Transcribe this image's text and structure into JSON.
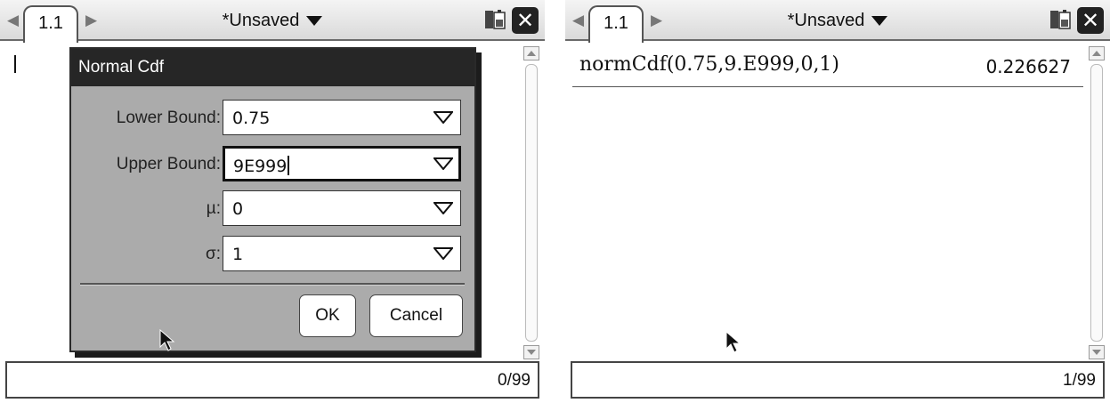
{
  "left_screen": {
    "page_tab": "1.1",
    "doc_title": "*Unsaved",
    "status_count": "0/99",
    "dialog": {
      "title": "Normal Cdf",
      "fields": [
        {
          "label": "Lower Bound:",
          "value": "0.75"
        },
        {
          "label": "Upper Bound:",
          "value": "9E999"
        },
        {
          "label": "µ:",
          "value": "0"
        },
        {
          "label": "σ:",
          "value": "1"
        }
      ],
      "ok_label": "OK",
      "cancel_label": "Cancel"
    }
  },
  "right_screen": {
    "page_tab": "1.1",
    "doc_title": "*Unsaved",
    "status_count": "1/99",
    "history": [
      {
        "expression": "normCdf(0.75,9.E999,0,1)",
        "result": "0.226627"
      }
    ]
  },
  "icons": {
    "battery": "battery-icon",
    "close": "close-icon",
    "dropdown": "chevron-down-icon",
    "pointer": "mouse-pointer-icon"
  },
  "colors": {
    "dialog_title_bg": "#262626",
    "dialog_bg": "#ababab"
  }
}
